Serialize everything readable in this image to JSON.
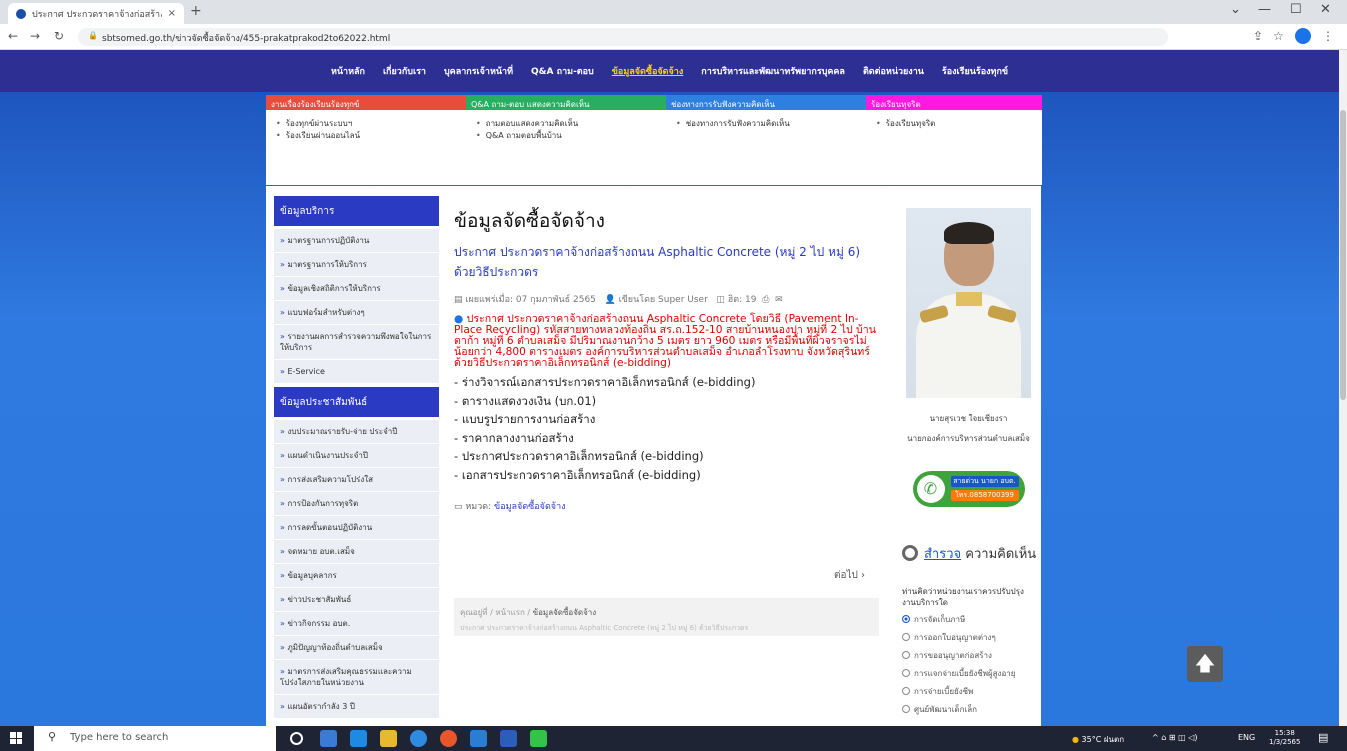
{
  "browser": {
    "tab_title": "ประกาศ ประกวดราคาจ้างก่อสร้างถนน",
    "tab_close": "×",
    "new_tab": "+",
    "url": "sbtsomed.go.th/ข่าวจัดซื้อจัดจ้าง/455-prakatprakod2to62022.html",
    "minimize": "—",
    "maximize": "☐",
    "close": "✕",
    "chevron": "⌄"
  },
  "topnav": [
    "หน้าหลัก",
    "เกี่ยวกับเรา",
    "บุคลากรเจ้าหน้าที่",
    "Q&A ถาม-ตอบ",
    "ข้อมูลจัดซื้อจัดจ้าง",
    "การบริหารและพัฒนาทรัพยากรบุคคล",
    "ติดต่อหน่วยงาน",
    "ร้องเรียนร้องทุกข์"
  ],
  "topnav_active": 4,
  "mega_menu": [
    {
      "header": "งานเรื่องร้องเรียนร้องทุกข์",
      "color": "#e74c3c",
      "items": [
        "ร้องทุกข์ผ่านระบบฯ",
        "ร้องเรียนผ่านออนไลน์"
      ]
    },
    {
      "header": "Q&A ถาม-ตอบ แสดงความคิดเห็น",
      "color": "#27ae60",
      "items": [
        "ถามตอบแสดงความคิดเห็น",
        "Q&A ถามตอบพื้นบ้าน"
      ]
    },
    {
      "header": "ช่องทางการรับฟังความคิดเห็น",
      "color": "#2d7fe0",
      "items": [
        "ช่องทางการรับฟังความคิดเห็น"
      ]
    },
    {
      "header": "ร้องเรียนทุจริต",
      "color": "#ff19e0",
      "items": [
        "ร้องเรียนทุจริต"
      ]
    }
  ],
  "sidebar": {
    "section1_title": "ข้อมูลบริการ",
    "section1_items": [
      "มาตรฐานการปฏิบัติงาน",
      "มาตรฐานการให้บริการ",
      "ข้อมูลเชิงสถิติการให้บริการ",
      "แบบฟอร์มสำหรับต่างๆ",
      "รายงานผลการสำรวจความพึงพอใจในการให้บริการ",
      "E-Service"
    ],
    "section2_title": "ข้อมูลประชาสัมพันธ์",
    "section2_items": [
      "งบประมาณรายรับ-จ่าย ประจำปี",
      "แผนดำเนินงานประจำปี",
      "การส่งเสริมความโปร่งใส",
      "การป้องกันการทุจริต",
      "การลดขั้นตอนปฏิบัติงาน",
      "จดหมาย อบต.เสม็จ",
      "ข้อมูลบุคลากร",
      "ข่าวประชาสัมพันธ์",
      "ข่าวกิจกรรม อบต.",
      "ภูมิปัญญาท้องถิ่นตำบลเสม็จ",
      "มาตรการส่งเสริมคุณธรรมและความโปร่งใสภายในหน่วยงาน",
      "แผนอัตรากำลัง 3 ปี"
    ]
  },
  "article": {
    "heading": "ข้อมูลจัดซื้อจัดจ้าง",
    "title": "ประกาศ ประกวดราคาจ้างก่อสร้างถนน Asphaltic Concrete (หมู่ 2 ไป หมู่ 6) ด้วยวิธีประกวดร",
    "published": "เผยแพร่เมื่อ: 07 กุมภาพันธ์ 2565",
    "author": "เขียนโดย Super User",
    "hits": "ฮิต: 19",
    "alert": "ประกาศ ประกวดราคาจ้างก่อสร้างถนน Asphaltic Concrete โดยวิธี (Pavement In-Place Recycling) รหัสสายทางหลวงท้องถิ่น สร.ถ.152-10 สายบ้านหนองปา หมู่ที่ 2 ไป บ้านตาก้า หมู่ที่ 6 ตำบลเสม็จ มีปริมาณงานกว้าง 5 เมตร ยาว 960 เมตร หรือมีพื้นที่ผิวจราจรไม่น้อยกว่า 4,800 ตารางเมตร องค์การบริหารส่วนตำบลเสม็จ อำเภอลำโรงทาบ จังหวัดสุรินทร์ ด้วยวิธีประกวดราคาอิเล็กทรอนิกส์ (e-bidding)",
    "documents": [
      "ร่างวิจารณ์เอกสารประกวดราคาอิเล็กทรอนิกส์ (e-bidding)",
      "ตารางแสดงวงเงิน (บก.01)",
      "แบบรูปรายการงานก่อสร้าง",
      "ราคากลางงานก่อสร้าง",
      "ประกาศประกวดราคาอิเล็กทรอนิกส์ (e-bidding)",
      "เอกสารประกวดราคาอิเล็กทรอนิกส์ (e-bidding)"
    ],
    "category_label": "หมวด:",
    "category": "ข้อมูลจัดซื้อจัดจ้าง",
    "next": "ต่อไป ›"
  },
  "breadcrumb": {
    "items": [
      "คุณอยู่ที่",
      "หน้าแรก",
      "ข้อมูลจัดซื้อจัดจ้าง"
    ],
    "sub": "ประกาศ ประกวดราคาจ้างก่อสร้างถนน Asphaltic Concrete (หมู่ 2 ไป หมู่ 6) ด้วยวิธีประกวดร"
  },
  "right": {
    "name": "นายสุรเวช ใจยเชียงรา",
    "position": "นายกองค์การบริหารส่วนตำบลเสม็จ",
    "call_line1": "สายด่วน นายก อบต.",
    "call_line2": "โทร.0858700399",
    "survey_title_a": "สำรวจ",
    "survey_title_b": " ความคิดเห็น",
    "survey_question": "ท่านคิดว่าหน่วยงานเราควรปรับปรุงงานบริการใด",
    "options": [
      "การจัดเก็บภาษี",
      "การออกใบอนุญาตต่างๆ",
      "การขออนุญาตก่อสร้าง",
      "การแจกจ่ายเบี้ยยังชีพผู้สูงอายุ",
      "การจ่ายเบี้ยยังชีพ",
      "ศูนย์พัฒนาเด็กเล็ก"
    ],
    "selected": 0
  },
  "taskbar": {
    "search_placeholder": "Type here to search",
    "weather": "35°C ฝนตก",
    "lang": "ENG",
    "time": "15:38",
    "date": "1/3/2565"
  },
  "colors": {
    "nav": "#2d2f93",
    "accent": "#2a3ac2",
    "alert": "#e00000",
    "page_bg": "#2a77dd"
  }
}
